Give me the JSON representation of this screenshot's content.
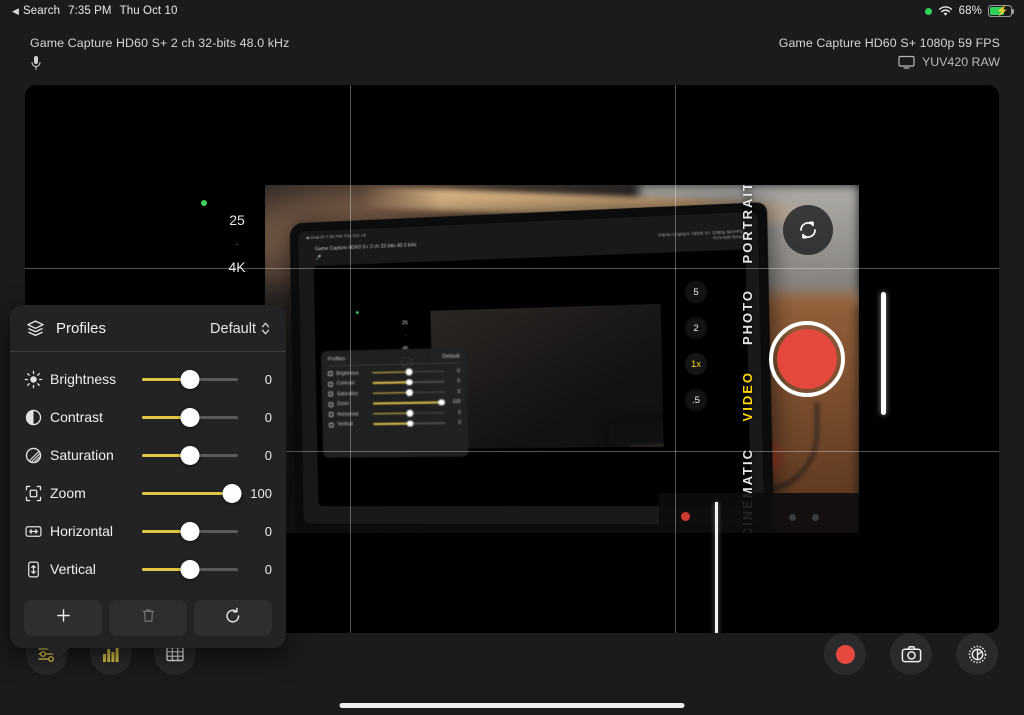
{
  "status_bar": {
    "back_label": "Search",
    "back_icon": "back-triangle-icon",
    "time": "7:35 PM",
    "date": "Thu Oct 10",
    "recording_dot_color": "#30d158",
    "wifi_icon": "wifi-icon",
    "battery_percent": "68%",
    "battery_level": 68,
    "battery_charging": true
  },
  "header": {
    "audio": {
      "source": "Game Capture HD60 S+  2 ch 32-bits 48.0 kHz",
      "icon": "microphone-icon"
    },
    "video": {
      "source": "Game Capture HD60 S+  1080p 59 FPS",
      "format": "YUV420 RAW",
      "icon": "display-icon"
    }
  },
  "preview": {
    "grid_overlay": true,
    "captured_scene": {
      "description": "recursive capture of the iPad screen plus an iPhone camera UI",
      "camera_ui": {
        "modes": [
          "PORTRAIT",
          "PHOTO",
          "VIDEO",
          "CINEMATIC"
        ],
        "active_mode": "VIDEO",
        "zoom_levels": [
          "5",
          "2",
          "1x",
          ".5"
        ],
        "active_zoom": "1x",
        "shutter_icon": "record-button-icon",
        "flip_icon": "camera-flip-icon"
      },
      "capture_settings": {
        "fps": "25",
        "separator": "·",
        "resolution": "4K",
        "flash": "flash-off-icon"
      },
      "mini_screen": {
        "status": "◀ Search  7:35 PM  Thu Oct 10",
        "audio_info": "Game Capture HD60 S+  2 ch 32-bits 48.0 kHz",
        "video_info": "Game Capture HD60 S+  1080p 59 FPS",
        "video_format": "YUV420 RAW",
        "fps": "25",
        "resolution": "4K"
      }
    }
  },
  "adjustments_panel": {
    "profiles_label": "Profiles",
    "profiles_icon": "layers-stack-icon",
    "selected_profile": "Default",
    "profile_chevron_icon": "chevron-up-down-icon",
    "accent_color": "#e0c644",
    "sliders": [
      {
        "icon": "brightness-sun-icon",
        "label": "Brightness",
        "value": "0",
        "percent": 50
      },
      {
        "icon": "contrast-circle-icon",
        "label": "Contrast",
        "value": "0",
        "percent": 50
      },
      {
        "icon": "saturation-circle-icon",
        "label": "Saturation",
        "value": "0",
        "percent": 50
      },
      {
        "icon": "zoom-frame-icon",
        "label": "Zoom",
        "value": "100",
        "percent": 94
      },
      {
        "icon": "horizontal-arrows-icon",
        "label": "Horizontal",
        "value": "0",
        "percent": 50
      },
      {
        "icon": "vertical-arrows-icon",
        "label": "Vertical",
        "value": "0",
        "percent": 50
      }
    ],
    "actions": [
      {
        "name": "add-profile-button",
        "icon": "plus-icon",
        "glyph": "+",
        "enabled": true
      },
      {
        "name": "delete-profile-button",
        "icon": "trash-icon",
        "glyph": "🗑",
        "enabled": false
      },
      {
        "name": "reset-profile-button",
        "icon": "reset-arrow-icon",
        "glyph": "↺",
        "enabled": true
      }
    ]
  },
  "toolbar": {
    "left": [
      {
        "name": "adjustments-button",
        "icon": "sliders-icon",
        "active": true
      },
      {
        "name": "histogram-button",
        "icon": "histogram-icon",
        "active": true
      },
      {
        "name": "grid-button",
        "icon": "grid-icon",
        "active": false
      }
    ],
    "right": [
      {
        "name": "record-button",
        "icon": "record-dot-icon"
      },
      {
        "name": "snapshot-button",
        "icon": "camera-icon"
      },
      {
        "name": "settings-button",
        "icon": "gear-icon"
      }
    ]
  }
}
